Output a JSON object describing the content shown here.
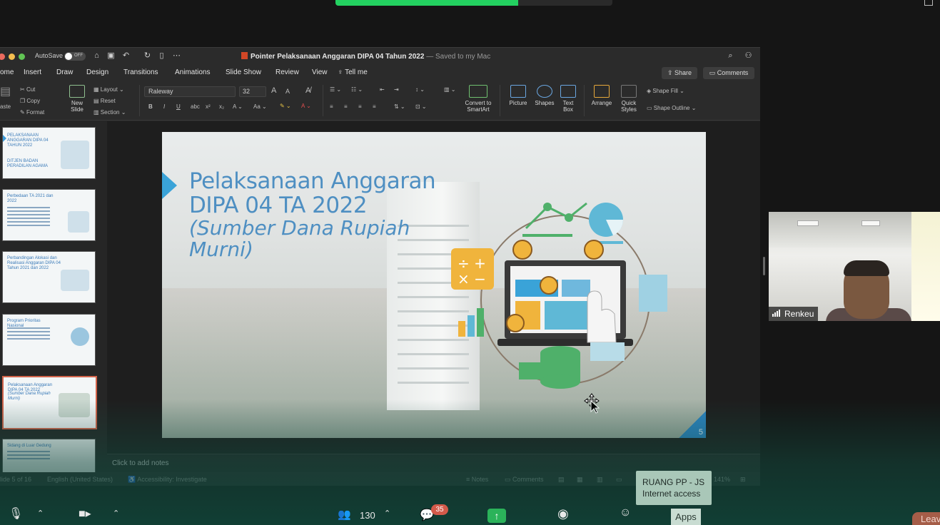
{
  "titlebar": {
    "autosave_label": "AutoSave",
    "toggle_state": "OFF",
    "document_title": "Pointer Pelaksanaan Anggaran DIPA 04 Tahun 2022",
    "document_status": "— Saved to my Mac"
  },
  "tabs": [
    "ome",
    "Insert",
    "Draw",
    "Design",
    "Transitions",
    "Animations",
    "Slide Show",
    "Review",
    "View",
    "Tell me"
  ],
  "share_label": "Share",
  "comments_label": "Comments",
  "ribbon": {
    "paste": "aste",
    "cut": "Cut",
    "copy": "Copy",
    "format": "Format",
    "new_slide": "New Slide",
    "layout": "Layout",
    "reset": "Reset",
    "section": "Section",
    "font": "Raleway",
    "size": "32",
    "convert_smartart": "Convert to SmartArt",
    "picture": "Picture",
    "shapes": "Shapes",
    "text_box": "Text Box",
    "arrange": "Arrange",
    "quick_styles": "Quick Styles",
    "shape_fill": "Shape Fill",
    "shape_outline": "Shape Outline"
  },
  "thumbnails": [
    {
      "title": "PELAKSANAAN ANGGARAN DIPA 04 TAHUN 2022",
      "sub": "DITJEN BADAN PERADILAN AGAMA"
    },
    {
      "title": "Perbedaan TA 2021 dan 2022",
      "sub": ""
    },
    {
      "title": "Perbandingan Alokasi dan Realisasi Anggaran DIPA 04 Tahun 2021 dan 2022",
      "sub": ""
    },
    {
      "title": "Program Prioritas Nasional",
      "sub": ""
    },
    {
      "title": "Pelaksanaan Anggaran DIPA 04 TA 2022",
      "sub": "(Sumber Dana Rupiah Murni)"
    },
    {
      "title": "Sidang di Luar Gedung",
      "sub": ""
    }
  ],
  "slide": {
    "title_line1": "Pelaksanaan Anggaran",
    "title_line2": "DIPA 04 TA 2022",
    "subtitle": "(Sumber Dana Rupiah Murni)",
    "page_number": "5"
  },
  "notes_placeholder": "Click to add notes",
  "statusbar": {
    "slide_info": "lide 5 of 16",
    "language": "English (United States)",
    "accessibility": "Accessibility: Investigate",
    "notes": "Notes",
    "comments": "Comments",
    "zoom": "141%"
  },
  "participant": {
    "name": "Renkeu"
  },
  "tooltip": {
    "line1": "RUANG PP - JS",
    "line2": "Internet access"
  },
  "zoom_toolbar": {
    "participants_count": "130",
    "chat_badge": "35",
    "apps_label": "Apps",
    "leave_label": "Leave"
  },
  "colors": {
    "slide_title": "#4e8fc2",
    "accent_blue": "#3aa3d8",
    "ppt_red": "#d24726",
    "zoom_green": "#23d160"
  }
}
